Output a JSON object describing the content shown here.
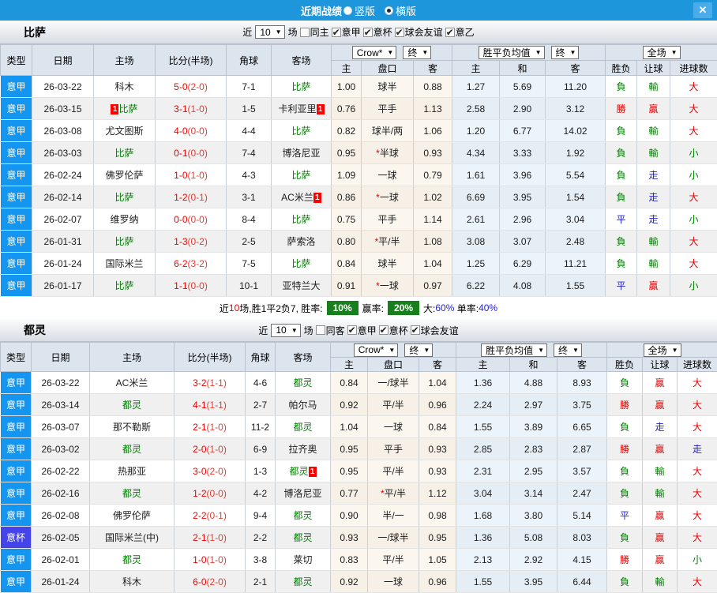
{
  "colors": {
    "topbar_bg": "#1e96dc",
    "close_bg": "#4aacea",
    "serie_a_bg": "#1496f0",
    "cup_bg": "#4444ea",
    "red": "#e60000",
    "green": "#008000",
    "blue": "#2323cf",
    "badge_green": "#17801c",
    "header_bg": "#dce4ee"
  },
  "topbar": {
    "title": "近期战绩",
    "layout_vertical": "竖版",
    "layout_horizontal": "横版",
    "close": "✕"
  },
  "sections": [
    {
      "team": "比萨",
      "filters": {
        "near": "近",
        "count": "10",
        "unit": "场",
        "same_label": "同主",
        "same_checked": false,
        "leagues": [
          {
            "label": "意甲",
            "checked": true
          },
          {
            "label": "意杯",
            "checked": true
          },
          {
            "label": "球会友谊",
            "checked": true
          },
          {
            "label": "意乙",
            "checked": true
          }
        ]
      },
      "header": {
        "type": "类型",
        "date": "日期",
        "home": "主场",
        "score": "比分(半场)",
        "corner": "角球",
        "away": "客场",
        "odds_select": "Crow*",
        "odds_final": "终",
        "avg_select": "胜平负均值",
        "avg_final": "终",
        "result_select": "全场",
        "sub": [
          "主",
          "盘口",
          "客",
          "主",
          "和",
          "客",
          "胜负",
          "让球",
          "进球数"
        ]
      },
      "rows": [
        {
          "type": "意甲",
          "date": "26-03-22",
          "home": "科木",
          "homeSelf": false,
          "homeCard": false,
          "score": "5-0",
          "half": "(2-0)",
          "corner": "7-1",
          "away": "比萨",
          "awaySelf": true,
          "awayCard": false,
          "o": [
            "1.00",
            "球半",
            "0.88"
          ],
          "a": [
            "1.27",
            "5.69",
            "11.20"
          ],
          "r": [
            "負",
            "輸",
            "大"
          ]
        },
        {
          "type": "意甲",
          "date": "26-03-15",
          "home": "比萨",
          "homeSelf": true,
          "homeCard": true,
          "score": "3-1",
          "half": "(1-0)",
          "corner": "1-5",
          "away": "卡利亚里",
          "awaySelf": false,
          "awayCard": true,
          "o": [
            "0.76",
            "平手",
            "1.13"
          ],
          "a": [
            "2.58",
            "2.90",
            "3.12"
          ],
          "r": [
            "勝",
            "贏",
            "大"
          ]
        },
        {
          "type": "意甲",
          "date": "26-03-08",
          "home": "尤文图斯",
          "homeSelf": false,
          "homeCard": false,
          "score": "4-0",
          "half": "(0-0)",
          "corner": "4-4",
          "away": "比萨",
          "awaySelf": true,
          "awayCard": false,
          "o": [
            "0.82",
            "球半/两",
            "1.06"
          ],
          "a": [
            "1.20",
            "6.77",
            "14.02"
          ],
          "r": [
            "負",
            "輸",
            "大"
          ]
        },
        {
          "type": "意甲",
          "date": "26-03-03",
          "home": "比萨",
          "homeSelf": true,
          "homeCard": false,
          "score": "0-1",
          "half": "(0-0)",
          "corner": "7-4",
          "away": "博洛尼亚",
          "awaySelf": false,
          "awayCard": false,
          "o": [
            "0.95",
            "*半球",
            "0.93"
          ],
          "a": [
            "4.34",
            "3.33",
            "1.92"
          ],
          "r": [
            "負",
            "輸",
            "小"
          ]
        },
        {
          "type": "意甲",
          "date": "26-02-24",
          "home": "佛罗伦萨",
          "homeSelf": false,
          "homeCard": false,
          "score": "1-0",
          "half": "(1-0)",
          "corner": "4-3",
          "away": "比萨",
          "awaySelf": true,
          "awayCard": false,
          "o": [
            "1.09",
            "一球",
            "0.79"
          ],
          "a": [
            "1.61",
            "3.96",
            "5.54"
          ],
          "r": [
            "負",
            "走",
            "小"
          ]
        },
        {
          "type": "意甲",
          "date": "26-02-14",
          "home": "比萨",
          "homeSelf": true,
          "homeCard": false,
          "score": "1-2",
          "half": "(0-1)",
          "corner": "3-1",
          "away": "AC米兰",
          "awaySelf": false,
          "awayCard": true,
          "o": [
            "0.86",
            "*一球",
            "1.02"
          ],
          "a": [
            "6.69",
            "3.95",
            "1.54"
          ],
          "r": [
            "負",
            "走",
            "大"
          ]
        },
        {
          "type": "意甲",
          "date": "26-02-07",
          "home": "维罗纳",
          "homeSelf": false,
          "homeCard": false,
          "score": "0-0",
          "half": "(0-0)",
          "corner": "8-4",
          "away": "比萨",
          "awaySelf": true,
          "awayCard": false,
          "o": [
            "0.75",
            "平手",
            "1.14"
          ],
          "a": [
            "2.61",
            "2.96",
            "3.04"
          ],
          "r": [
            "平",
            "走",
            "小"
          ]
        },
        {
          "type": "意甲",
          "date": "26-01-31",
          "home": "比萨",
          "homeSelf": true,
          "homeCard": false,
          "score": "1-3",
          "half": "(0-2)",
          "corner": "2-5",
          "away": "萨索洛",
          "awaySelf": false,
          "awayCard": false,
          "o": [
            "0.80",
            "*平/半",
            "1.08"
          ],
          "a": [
            "3.08",
            "3.07",
            "2.48"
          ],
          "r": [
            "負",
            "輸",
            "大"
          ]
        },
        {
          "type": "意甲",
          "date": "26-01-24",
          "home": "国际米兰",
          "homeSelf": false,
          "homeCard": false,
          "score": "6-2",
          "half": "(3-2)",
          "corner": "7-5",
          "away": "比萨",
          "awaySelf": true,
          "awayCard": false,
          "o": [
            "0.84",
            "球半",
            "1.04"
          ],
          "a": [
            "1.25",
            "6.29",
            "11.21"
          ],
          "r": [
            "負",
            "輸",
            "大"
          ]
        },
        {
          "type": "意甲",
          "date": "26-01-17",
          "home": "比萨",
          "homeSelf": true,
          "homeCard": false,
          "score": "1-1",
          "half": "(0-0)",
          "corner": "10-1",
          "away": "亚特兰大",
          "awaySelf": false,
          "awayCard": false,
          "o": [
            "0.91",
            "*一球",
            "0.97"
          ],
          "a": [
            "6.22",
            "4.08",
            "1.55"
          ],
          "r": [
            "平",
            "贏",
            "小"
          ]
        }
      ],
      "summary": {
        "near": "近",
        "count": "10",
        "tail": "场,胜1平2负7, 胜率:",
        "win": "10%",
        "profit_label": "赢率:",
        "profit": "20%",
        "big_label": "大:",
        "big": "60%",
        "single_label": "单率:",
        "single": "40%"
      }
    },
    {
      "team": "都灵",
      "filters": {
        "near": "近",
        "count": "10",
        "unit": "场",
        "same_label": "同客",
        "same_checked": false,
        "leagues": [
          {
            "label": "意甲",
            "checked": true
          },
          {
            "label": "意杯",
            "checked": true
          },
          {
            "label": "球会友谊",
            "checked": true
          }
        ]
      },
      "header": {
        "type": "类型",
        "date": "日期",
        "home": "主场",
        "score": "比分(半场)",
        "corner": "角球",
        "away": "客场",
        "odds_select": "Crow*",
        "odds_final": "终",
        "avg_select": "胜平负均值",
        "avg_final": "终",
        "result_select": "全场",
        "sub": [
          "主",
          "盘口",
          "客",
          "主",
          "和",
          "客",
          "胜负",
          "让球",
          "进球数"
        ]
      },
      "rows": [
        {
          "type": "意甲",
          "date": "26-03-22",
          "home": "AC米兰",
          "homeSelf": false,
          "homeCard": false,
          "score": "3-2",
          "half": "(1-1)",
          "corner": "4-6",
          "away": "都灵",
          "awaySelf": true,
          "awayCard": false,
          "o": [
            "0.84",
            "一/球半",
            "1.04"
          ],
          "a": [
            "1.36",
            "4.88",
            "8.93"
          ],
          "r": [
            "負",
            "贏",
            "大"
          ]
        },
        {
          "type": "意甲",
          "date": "26-03-14",
          "home": "都灵",
          "homeSelf": true,
          "homeCard": false,
          "score": "4-1",
          "half": "(1-1)",
          "corner": "2-7",
          "away": "帕尔马",
          "awaySelf": false,
          "awayCard": false,
          "o": [
            "0.92",
            "平/半",
            "0.96"
          ],
          "a": [
            "2.24",
            "2.97",
            "3.75"
          ],
          "r": [
            "勝",
            "贏",
            "大"
          ]
        },
        {
          "type": "意甲",
          "date": "26-03-07",
          "home": "那不勒斯",
          "homeSelf": false,
          "homeCard": false,
          "score": "2-1",
          "half": "(1-0)",
          "corner": "11-2",
          "away": "都灵",
          "awaySelf": true,
          "awayCard": false,
          "o": [
            "1.04",
            "一球",
            "0.84"
          ],
          "a": [
            "1.55",
            "3.89",
            "6.65"
          ],
          "r": [
            "負",
            "走",
            "大"
          ]
        },
        {
          "type": "意甲",
          "date": "26-03-02",
          "home": "都灵",
          "homeSelf": true,
          "homeCard": false,
          "score": "2-0",
          "half": "(1-0)",
          "corner": "6-9",
          "away": "拉齐奥",
          "awaySelf": false,
          "awayCard": false,
          "o": [
            "0.95",
            "平手",
            "0.93"
          ],
          "a": [
            "2.85",
            "2.83",
            "2.87"
          ],
          "r": [
            "勝",
            "贏",
            "走"
          ]
        },
        {
          "type": "意甲",
          "date": "26-02-22",
          "home": "热那亚",
          "homeSelf": false,
          "homeCard": false,
          "score": "3-0",
          "half": "(2-0)",
          "corner": "1-3",
          "away": "都灵",
          "awaySelf": true,
          "awayCard": true,
          "o": [
            "0.95",
            "平/半",
            "0.93"
          ],
          "a": [
            "2.31",
            "2.95",
            "3.57"
          ],
          "r": [
            "負",
            "輸",
            "大"
          ]
        },
        {
          "type": "意甲",
          "date": "26-02-16",
          "home": "都灵",
          "homeSelf": true,
          "homeCard": false,
          "score": "1-2",
          "half": "(0-0)",
          "corner": "4-2",
          "away": "博洛尼亚",
          "awaySelf": false,
          "awayCard": false,
          "o": [
            "0.77",
            "*平/半",
            "1.12"
          ],
          "a": [
            "3.04",
            "3.14",
            "2.47"
          ],
          "r": [
            "負",
            "輸",
            "大"
          ]
        },
        {
          "type": "意甲",
          "date": "26-02-08",
          "home": "佛罗伦萨",
          "homeSelf": false,
          "homeCard": false,
          "score": "2-2",
          "half": "(0-1)",
          "corner": "9-4",
          "away": "都灵",
          "awaySelf": true,
          "awayCard": false,
          "o": [
            "0.90",
            "半/一",
            "0.98"
          ],
          "a": [
            "1.68",
            "3.80",
            "5.14"
          ],
          "r": [
            "平",
            "贏",
            "大"
          ]
        },
        {
          "type": "意杯",
          "date": "26-02-05",
          "home": "国际米兰(中)",
          "homeSelf": false,
          "homeCard": false,
          "score": "2-1",
          "half": "(1-0)",
          "corner": "2-2",
          "away": "都灵",
          "awaySelf": true,
          "awayCard": false,
          "o": [
            "0.93",
            "一/球半",
            "0.95"
          ],
          "a": [
            "1.36",
            "5.08",
            "8.03"
          ],
          "r": [
            "負",
            "贏",
            "大"
          ]
        },
        {
          "type": "意甲",
          "date": "26-02-01",
          "home": "都灵",
          "homeSelf": true,
          "homeCard": false,
          "score": "1-0",
          "half": "(1-0)",
          "corner": "3-8",
          "away": "莱切",
          "awaySelf": false,
          "awayCard": false,
          "o": [
            "0.83",
            "平/半",
            "1.05"
          ],
          "a": [
            "2.13",
            "2.92",
            "4.15"
          ],
          "r": [
            "勝",
            "贏",
            "小"
          ]
        },
        {
          "type": "意甲",
          "date": "26-01-24",
          "home": "科木",
          "homeSelf": false,
          "homeCard": false,
          "score": "6-0",
          "half": "(2-0)",
          "corner": "2-1",
          "away": "都灵",
          "awaySelf": true,
          "awayCard": false,
          "o": [
            "0.92",
            "一球",
            "0.96"
          ],
          "a": [
            "1.55",
            "3.95",
            "6.44"
          ],
          "r": [
            "負",
            "輸",
            "大"
          ]
        }
      ]
    }
  ]
}
